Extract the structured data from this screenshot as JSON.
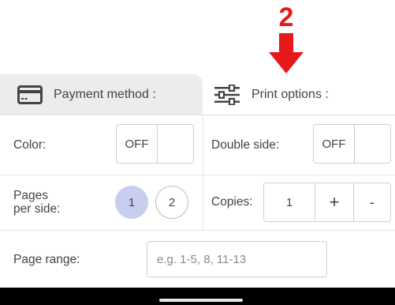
{
  "annotation": {
    "number": "2",
    "color": "#e8191a"
  },
  "tabs": {
    "payment": {
      "label": "Payment method :",
      "icon": "credit-card-icon",
      "background": "#ececec"
    },
    "print": {
      "label": "Print options :",
      "icon": "sliders-icon"
    }
  },
  "color_option": {
    "label": "Color:",
    "toggle": "OFF"
  },
  "double_side": {
    "label": "Double side:",
    "toggle": "OFF"
  },
  "pages_per_side": {
    "label_line1": "Pages",
    "label_line2": "per side:",
    "options": [
      "1",
      "2"
    ],
    "selected": "1",
    "selected_color": "#c9cef0"
  },
  "copies": {
    "label": "Copies:",
    "value": "1",
    "plus": "+",
    "minus": "-"
  },
  "page_range": {
    "label": "Page range:",
    "placeholder": "e.g. 1-5, 8, 11-13",
    "value": ""
  }
}
